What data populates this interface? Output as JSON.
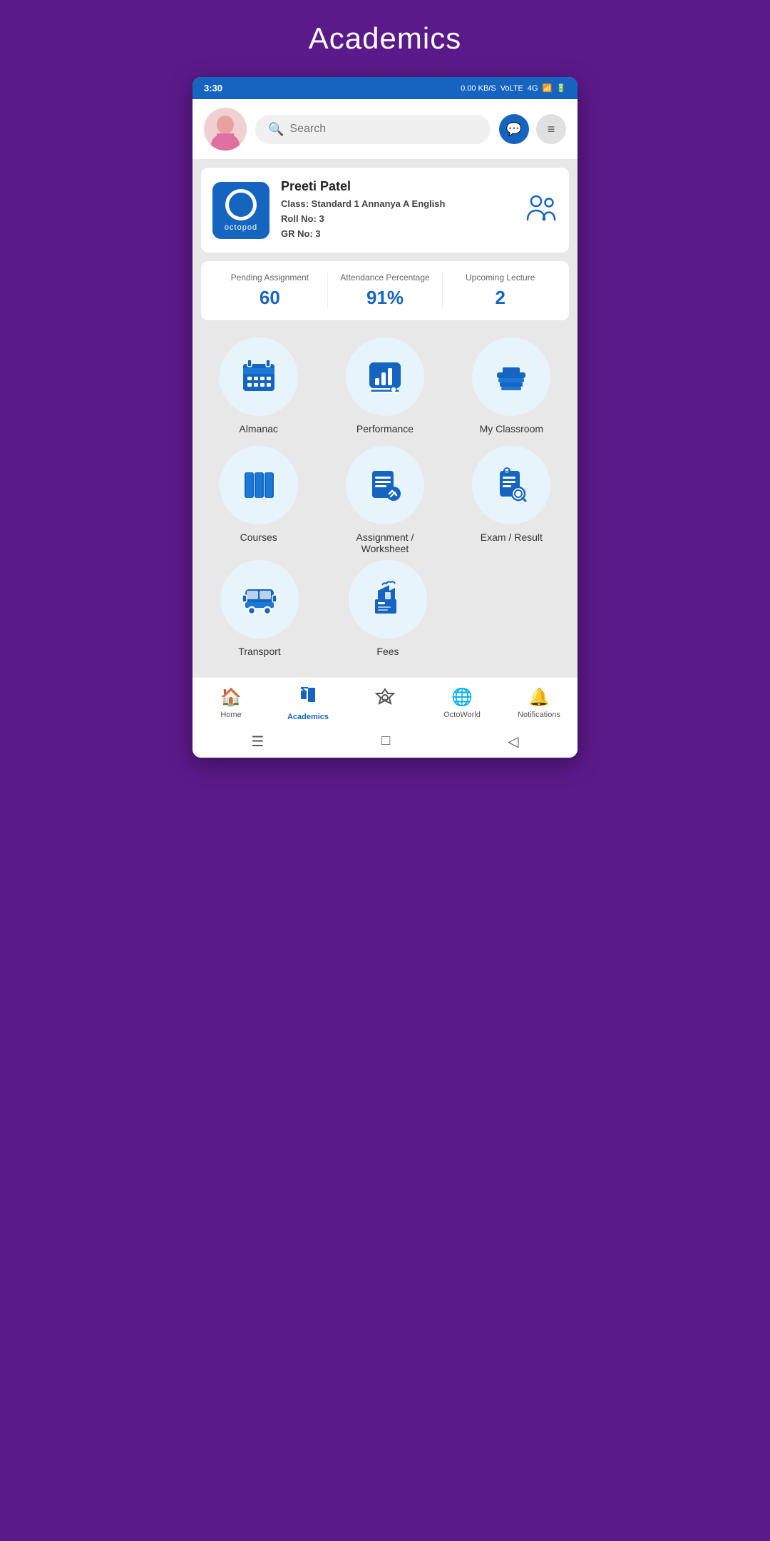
{
  "page": {
    "title": "Academics"
  },
  "statusBar": {
    "time": "3:30",
    "network": "0.00 KB/S",
    "sim": "Vo4G",
    "signal": "4G",
    "battery": "⑥"
  },
  "header": {
    "searchPlaceholder": "Search",
    "chatIcon": "💬",
    "menuIcon": "≡"
  },
  "profile": {
    "name": "Preeti Patel",
    "classLabel": "Class:",
    "classValue": "Standard 1 Annanya A English",
    "rollLabel": "Roll No:",
    "rollValue": "3",
    "grLabel": "GR No:",
    "grValue": "3",
    "logoText": "octopod"
  },
  "stats": [
    {
      "label": "Pending Assignment",
      "value": "60"
    },
    {
      "label": "Attendance Percentage",
      "value": "91%"
    },
    {
      "label": "Upcoming Lecture",
      "value": "2"
    }
  ],
  "gridItems": [
    {
      "id": "almanac",
      "label": "Almanac",
      "icon": "calendar"
    },
    {
      "id": "performance",
      "label": "Performance",
      "icon": "chart"
    },
    {
      "id": "my-classroom",
      "label": "My Classroom",
      "icon": "books-stack"
    },
    {
      "id": "courses",
      "label": "Courses",
      "icon": "books"
    },
    {
      "id": "assignment-worksheet",
      "label": "Assignment / Worksheet",
      "icon": "edit"
    },
    {
      "id": "exam-result",
      "label": "Exam / Result",
      "icon": "clipboard-search"
    },
    {
      "id": "transport",
      "label": "Transport",
      "icon": "bus"
    },
    {
      "id": "fees",
      "label": "Fees",
      "icon": "graduation"
    }
  ],
  "bottomNav": [
    {
      "id": "home",
      "label": "Home",
      "icon": "🏠",
      "active": false
    },
    {
      "id": "academics",
      "label": "Academics",
      "icon": "✏️",
      "active": true
    },
    {
      "id": "octoworld-center",
      "label": "",
      "icon": "🛡️",
      "active": false
    },
    {
      "id": "octoworld",
      "label": "OctoWorld",
      "icon": "🌐",
      "active": false
    },
    {
      "id": "notifications",
      "label": "Notifications",
      "icon": "🔔",
      "active": false
    }
  ]
}
